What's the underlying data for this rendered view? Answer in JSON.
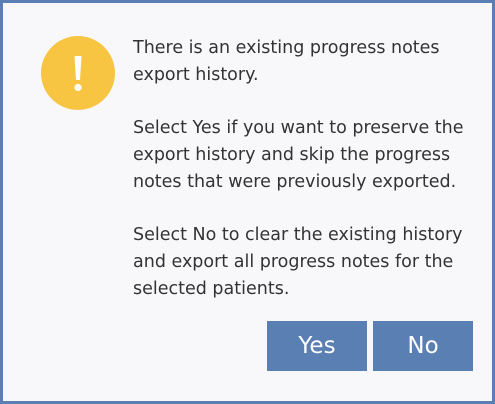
{
  "dialog": {
    "icon": "exclamation-icon",
    "icon_color": "#f8c543",
    "paragraphs": [
      "There is an existing progress notes export history.",
      "Select Yes if you want to preserve the export history and skip the progress notes that were previously exported.",
      "Select No to clear the existing history and export all progress notes for the selected patients."
    ],
    "buttons": {
      "yes_label": "Yes",
      "no_label": "No"
    },
    "accent_color": "#5a7fb3"
  }
}
